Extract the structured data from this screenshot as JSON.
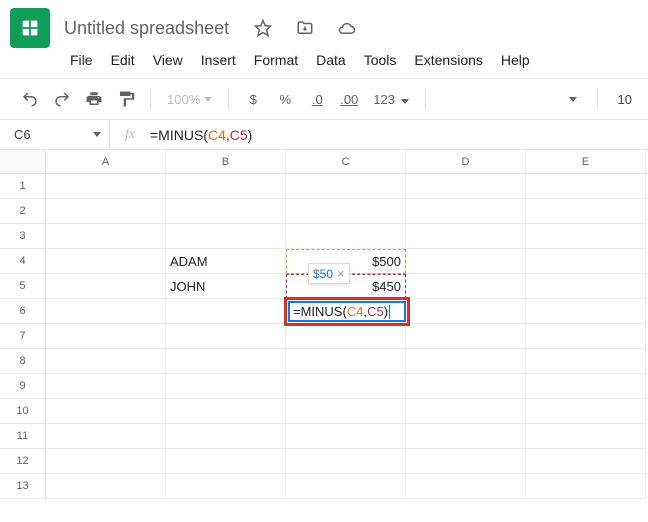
{
  "header": {
    "title": "Untitled spreadsheet"
  },
  "menu": {
    "file": "File",
    "edit": "Edit",
    "view": "View",
    "insert": "Insert",
    "format": "Format",
    "data": "Data",
    "tools": "Tools",
    "extensions": "Extensions",
    "help": "Help"
  },
  "toolbar": {
    "zoom": "100%",
    "currency": "$",
    "percent": "%",
    "dec_dec": ".0",
    "inc_dec": ".00",
    "num_format": "123",
    "font_size": "10"
  },
  "namebox": "C6",
  "formula": {
    "fn": "=MINUS",
    "ref1": "C4",
    "ref2": "C5",
    "open": "(",
    "comma": ",",
    "close": ")"
  },
  "columns": [
    "A",
    "B",
    "C",
    "D",
    "E"
  ],
  "row_numbers": [
    "1",
    "2",
    "3",
    "4",
    "5",
    "6",
    "7",
    "8",
    "9",
    "10",
    "11",
    "12",
    "13"
  ],
  "cells": {
    "B4": "ADAM",
    "B5": "JOHN",
    "C4": "$500",
    "C5": "$450"
  },
  "tooltip": {
    "value": "$50",
    "close": "×"
  }
}
